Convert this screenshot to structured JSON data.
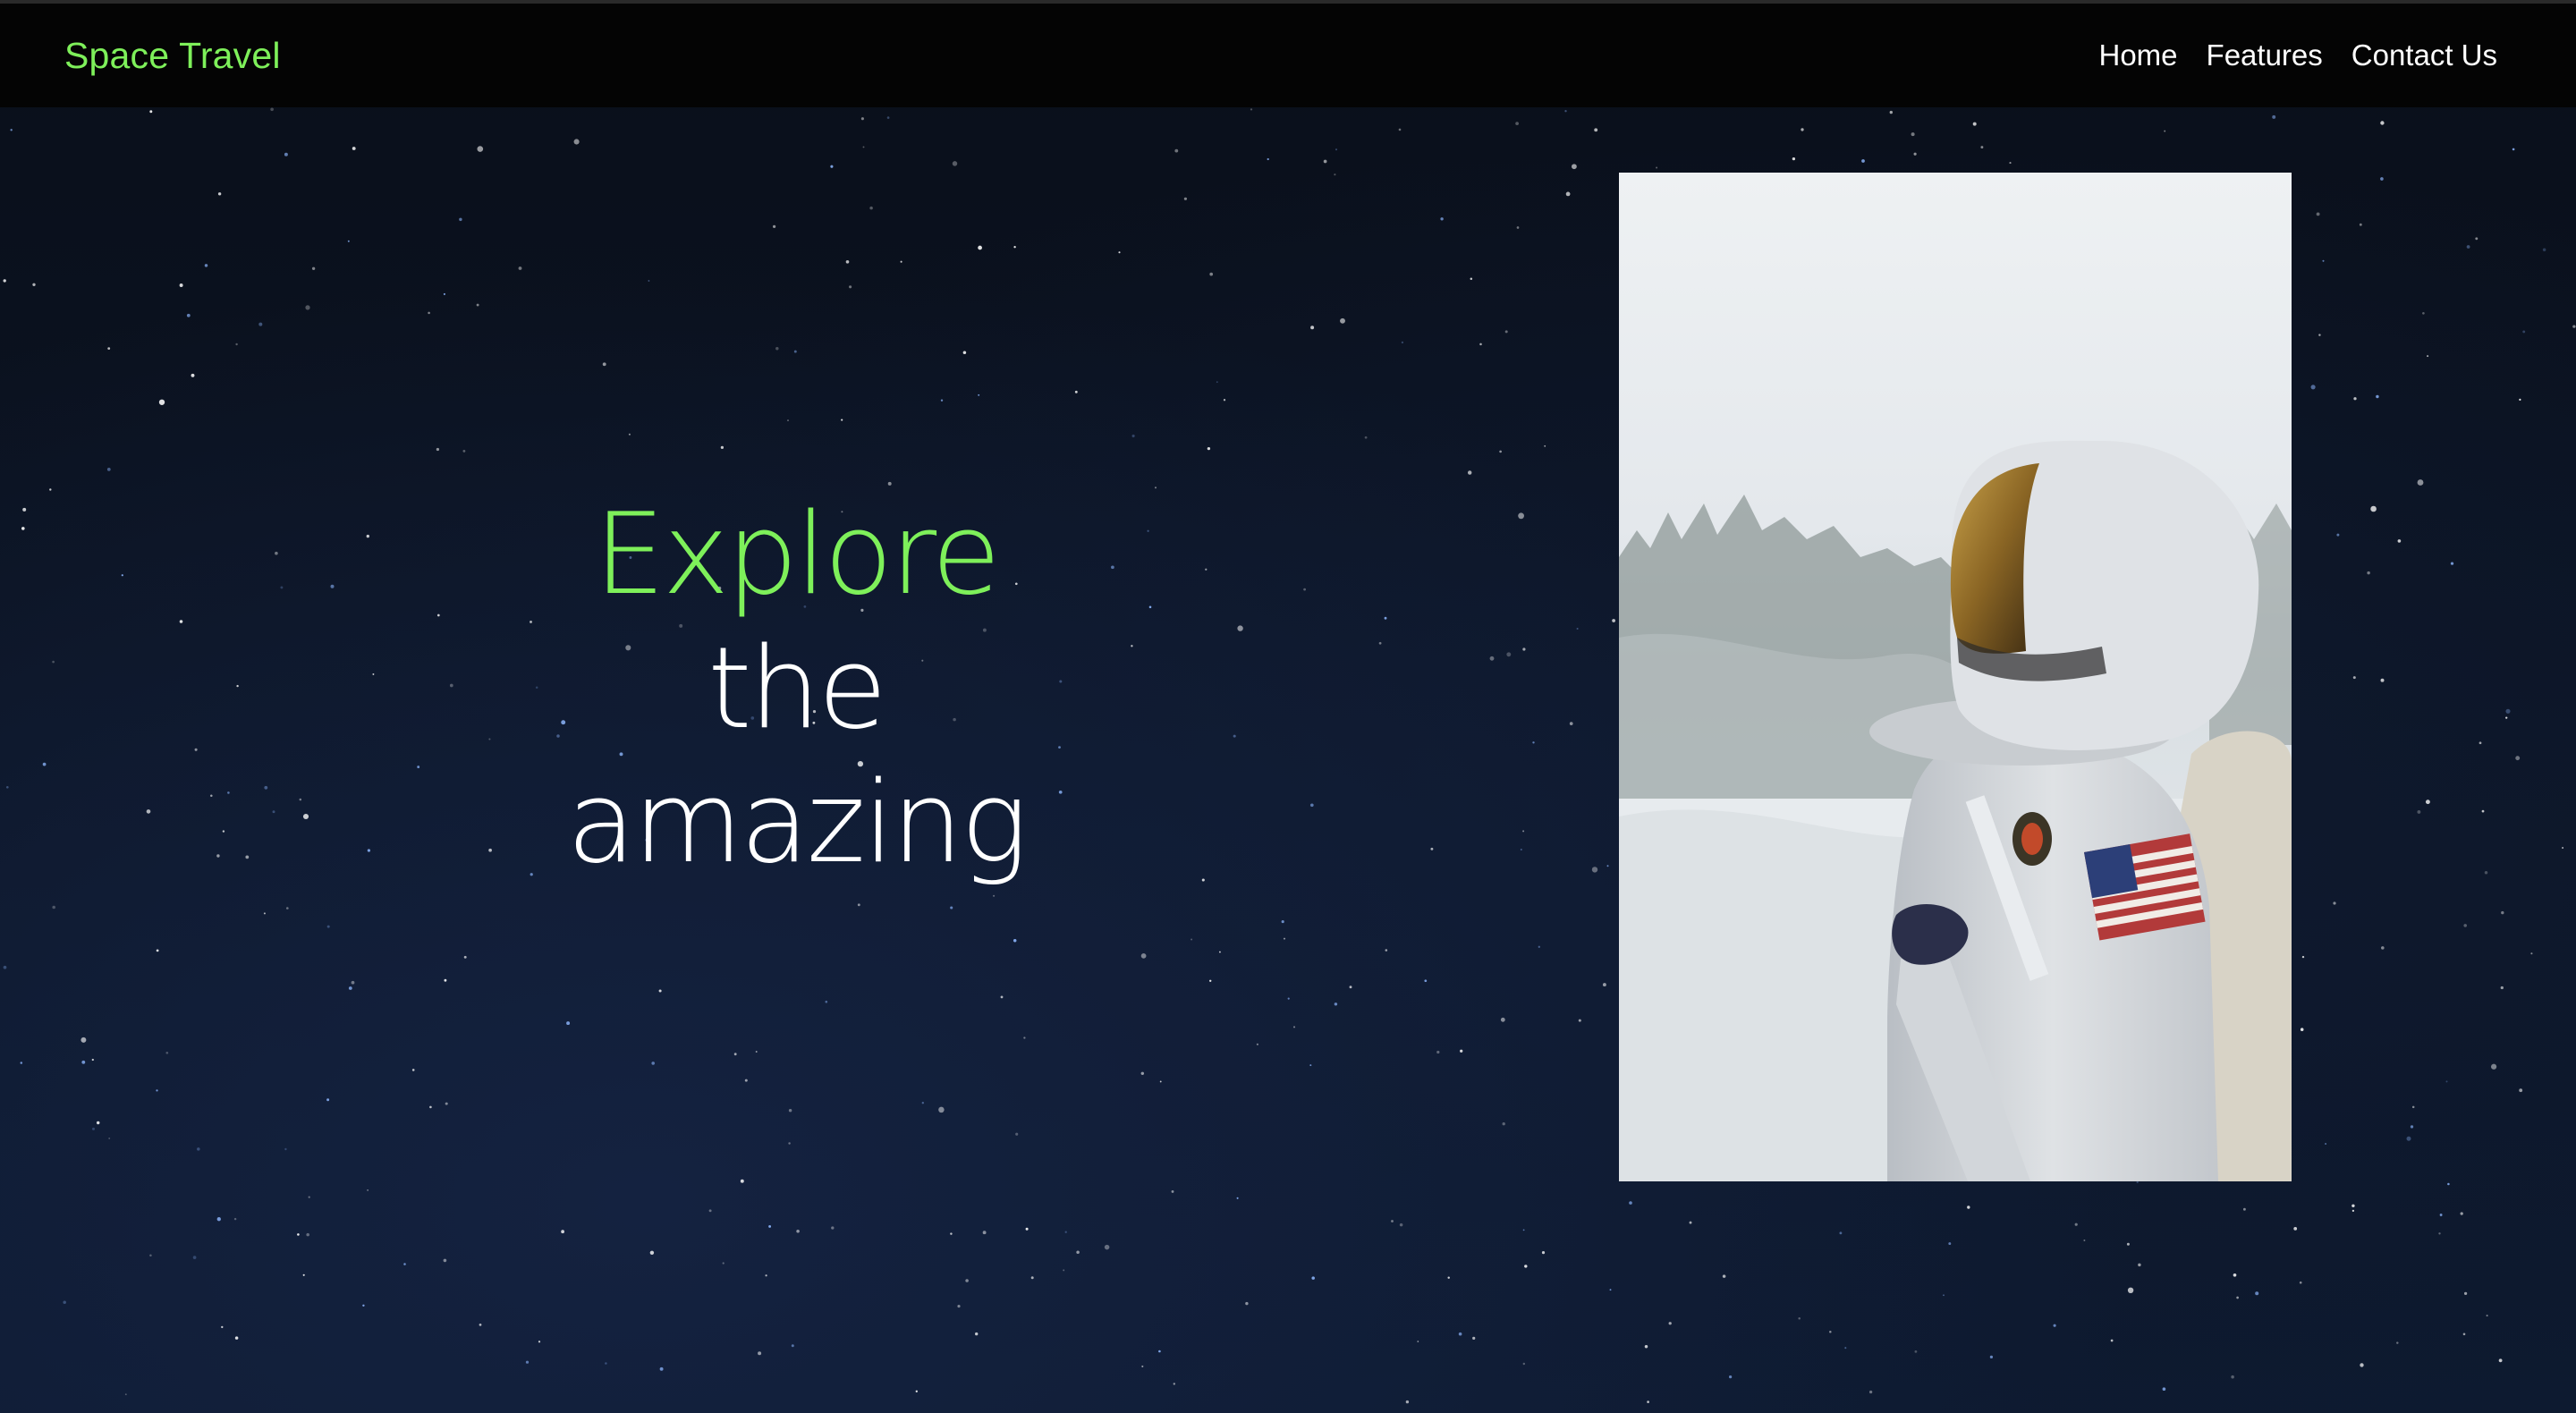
{
  "navbar": {
    "brand": "Space Travel",
    "links": [
      {
        "label": "Home"
      },
      {
        "label": "Features"
      },
      {
        "label": "Contact Us"
      }
    ]
  },
  "hero": {
    "line1": "Explore",
    "line2": "the amazing"
  },
  "colors": {
    "accent": "#7ef05a",
    "navbar_bg": "#040404",
    "page_bg": "#0b1322",
    "text": "#ffffff"
  },
  "icons": {
    "hero_image": "astronaut-photo"
  }
}
